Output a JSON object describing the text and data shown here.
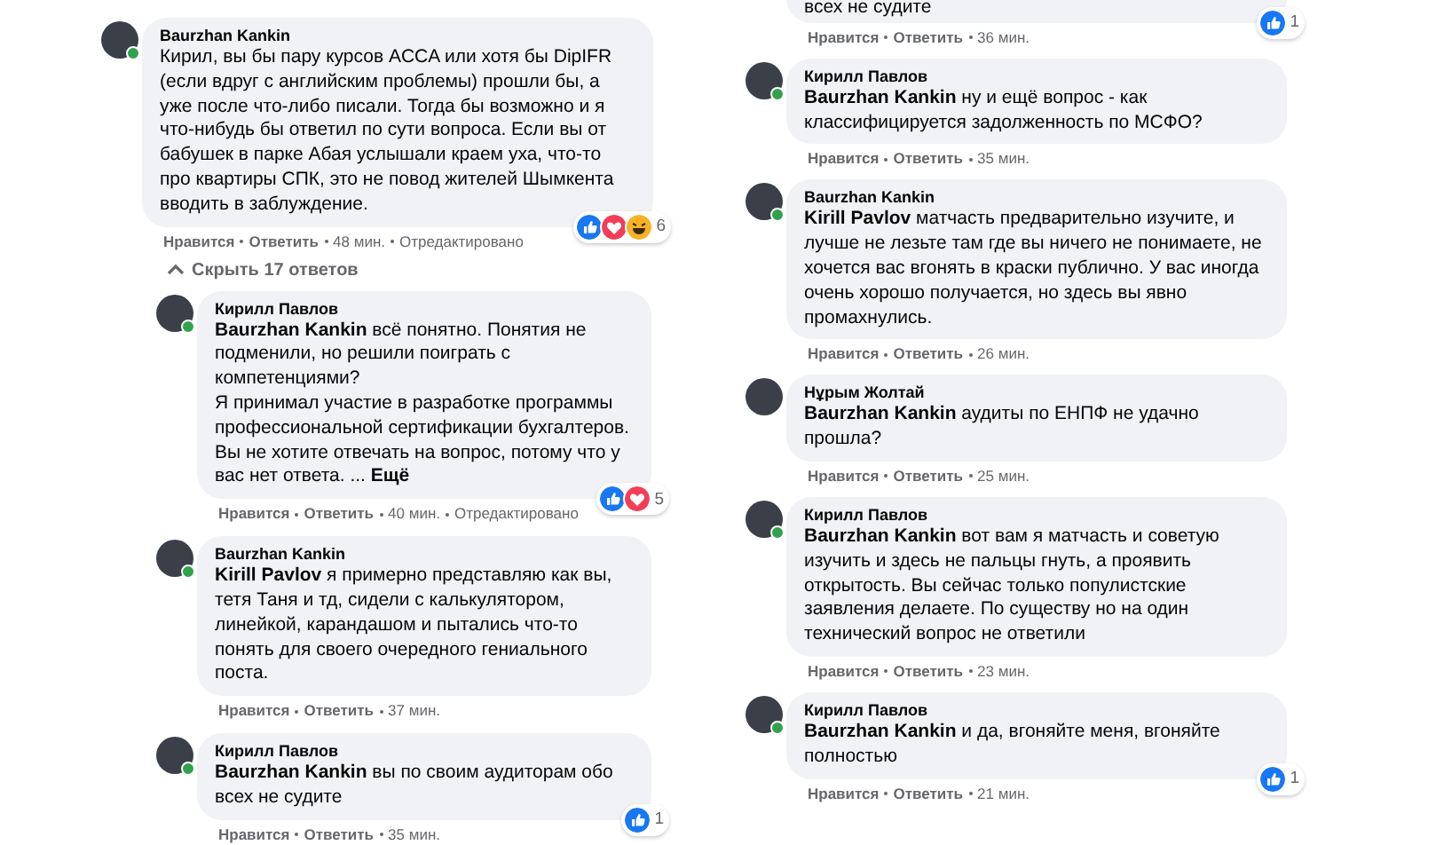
{
  "columns": [
    {
      "comments": [
        {
          "author": "Baurzhan Kankin",
          "online": true,
          "text": "Кирил, вы бы пару курсов ACCA или хотя бы DipIFR (если вдруг с английским проблемы) прошли бы, а уже после что-либо писали. Тогда бы возможно и я что-нибудь бы ответил по сути вопроса. Если вы от бабушек в парке Абая услышали краем уха, что-то про квартиры СПК, это не повод жителей Шымкента вводить в заблуждение.",
          "meta": {
            "like": "Нравится",
            "reply": "Ответить",
            "time": "48 мин.",
            "edited": "Отредактировано"
          },
          "reactions": {
            "icons": [
              {
                "kind": "like"
              },
              {
                "kind": "love"
              },
              {
                "kind": "haha"
              }
            ],
            "count": "6"
          },
          "replies_toggle": {
            "label": "Скрыть 17 ответов",
            "expanded": true
          },
          "children": [
            {
              "author": "Кирилл Павлов",
              "online": true,
              "text": "**Baurzhan Kankin** всё понятно. Понятия не подменили, но решили поиграть с компетенциями?\nЯ принимал участие в разработке программы профессиональной сертификации бухгалтеров.\nВы не хотите отвечать на вопрос, потому что у вас нет ответа. ...",
              "more": "Ещё",
              "meta": {
                "like": "Нравится",
                "reply": "Ответить",
                "time": "40 мин.",
                "edited": "Отредактировано"
              },
              "reactions": {
                "icons": [
                  {
                    "kind": "like"
                  },
                  {
                    "kind": "love"
                  }
                ],
                "count": "5"
              }
            },
            {
              "author": "Baurzhan Kankin",
              "online": true,
              "text": "**Kirill Pavlov** я примерно представляю как вы, тетя Таня и тд, сидели с калькулятором, линейкой, карандашом и пытались что-то понять для своего очередного гениального поста.",
              "meta": {
                "like": "Нравится",
                "reply": "Ответить",
                "time": "37 мин."
              }
            },
            {
              "author": "Кирилл Павлов",
              "online": true,
              "text": "**Baurzhan Kankin** вы по своим аудиторам обо всех не судите",
              "meta": {
                "like": "Нравится",
                "reply": "Ответить",
                "time": "35 мин."
              },
              "reactions": {
                "icons": [
                  {
                    "kind": "like"
                  }
                ],
                "count": "1"
              }
            }
          ]
        }
      ]
    },
    {
      "comments": [
        {
          "cut": true,
          "text": "всех не судите",
          "meta": {
            "like": "Нравится",
            "reply": "Ответить",
            "time": "36 мин."
          },
          "reactions": {
            "icons": [
              {
                "kind": "like"
              }
            ],
            "count": "1"
          }
        },
        {
          "author": "Кирилл Павлов",
          "online": true,
          "text": "**Baurzhan Kankin** ну и ещё вопрос - как классифицируется задолженность по МСФО?",
          "meta": {
            "like": "Нравится",
            "reply": "Ответить",
            "time": "35 мин."
          }
        },
        {
          "author": "Baurzhan Kankin",
          "online": true,
          "text": "**Kirill Pavlov** матчасть предварительно изучите, и лучше не лезьте там где вы ничего не понимаете, не хочется вас вгонять в краски публично. У вас иногда очень хорошо получается, но здесь вы явно промахнулись.",
          "meta": {
            "like": "Нравится",
            "reply": "Ответить",
            "time": "26 мин."
          }
        },
        {
          "author": "Нұрым Жолтай",
          "online": false,
          "text": "**Baurzhan Kankin** аудиты по ЕНПФ не удачно прошла?",
          "meta": {
            "like": "Нравится",
            "reply": "Ответить",
            "time": "25 мин."
          }
        },
        {
          "author": "Кирилл Павлов",
          "online": true,
          "text": "**Baurzhan Kankin** вот вам я матчасть и советую изучить и здесь не пальцы гнуть, а проявить открытость. Вы сейчас только популистские заявления делаете. По существу но на один технический вопрос не ответили",
          "meta": {
            "like": "Нравится",
            "reply": "Ответить",
            "time": "23 мин."
          }
        },
        {
          "author": "Кирилл Павлов",
          "online": true,
          "text": "**Baurzhan Kankin** и да, вгоняйте меня, вгоняйте полностью",
          "meta": {
            "like": "Нравится",
            "reply": "Ответить",
            "time": "21 мин."
          },
          "reactions": {
            "icons": [
              {
                "kind": "like"
              }
            ],
            "count": "1"
          }
        }
      ]
    }
  ]
}
